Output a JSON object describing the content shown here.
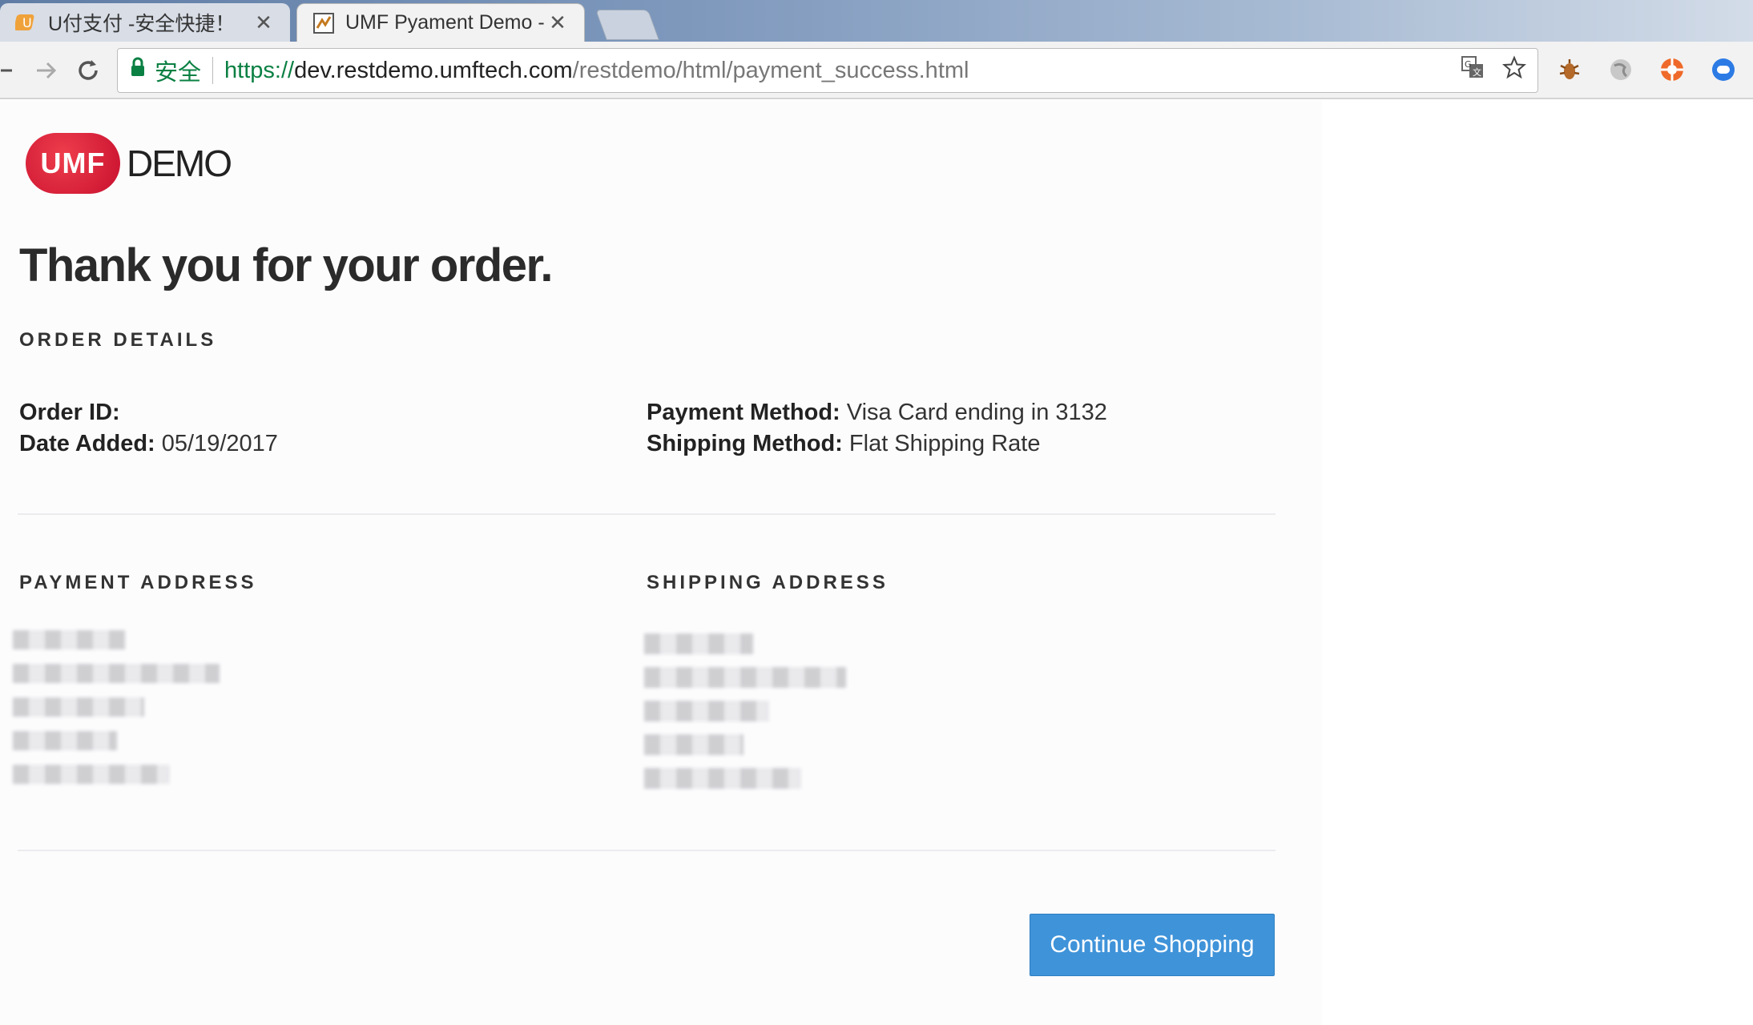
{
  "browser": {
    "tabs": [
      {
        "title": "U付支付 -安全快捷！",
        "close": "✕",
        "active": false
      },
      {
        "title": "UMF Pyament Demo -",
        "close": "✕",
        "active": true
      }
    ],
    "security_label": "安全",
    "url": {
      "scheme": "https://",
      "host": "dev.restdemo.umftech.com",
      "path": "/restdemo/html/payment_success.html"
    }
  },
  "logo": {
    "badge": "UMF",
    "text": "DEMO"
  },
  "page": {
    "title": "Thank you for your order.",
    "order_details_heading": "ORDER DETAILS",
    "order_id_label": "Order ID:",
    "order_id_value": "",
    "date_added_label": "Date Added:",
    "date_added_value": "05/19/2017",
    "payment_method_label": "Payment Method:",
    "payment_method_value": "Visa Card ending in 3132",
    "shipping_method_label": "Shipping Method:",
    "shipping_method_value": "Flat Shipping Rate",
    "payment_address_heading": "PAYMENT ADDRESS",
    "shipping_address_heading": "SHIPPING ADDRESS",
    "continue_button": "Continue Shopping"
  },
  "colors": {
    "accent": "#3f93d9",
    "brand_red": "#c8102e",
    "secure_green": "#0b8043"
  }
}
